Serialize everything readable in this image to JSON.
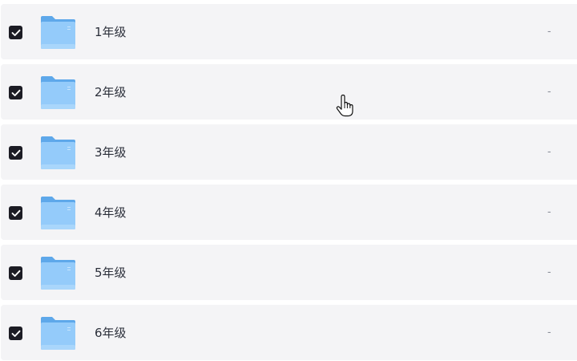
{
  "files": [
    {
      "name": "1年级",
      "size": "-",
      "checked": true,
      "icon": "folder-icon"
    },
    {
      "name": "2年级",
      "size": "-",
      "checked": true,
      "icon": "folder-icon"
    },
    {
      "name": "3年级",
      "size": "-",
      "checked": true,
      "icon": "folder-icon"
    },
    {
      "name": "4年级",
      "size": "-",
      "checked": true,
      "icon": "folder-icon"
    },
    {
      "name": "5年级",
      "size": "-",
      "checked": true,
      "icon": "folder-icon"
    },
    {
      "name": "6年级",
      "size": "-",
      "checked": true,
      "icon": "folder-icon"
    }
  ],
  "colors": {
    "row_background": "#f4f4f6",
    "checkbox_fill": "#1c1c24",
    "folder_blue": "#8ec8f8",
    "text": "#2b2f3a"
  },
  "cursor_icon": "hand-pointer-icon"
}
